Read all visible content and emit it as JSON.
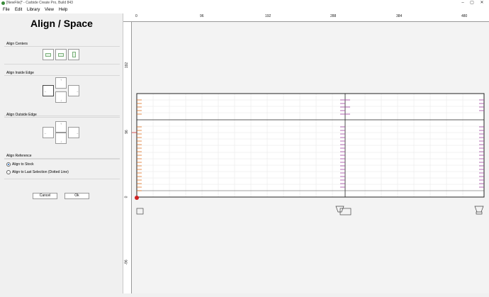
{
  "window": {
    "title": "[NewFile]* - Carbide Create Pro, Build 843",
    "min": "–",
    "max": "▢",
    "close": "✕"
  },
  "menu": [
    "File",
    "Edit",
    "Library",
    "View",
    "Help"
  ],
  "panel": {
    "title": "Align / Space",
    "align_centers": "Align Centers",
    "align_inside": "Align Inside Edge",
    "align_outside": "Align Outside Edge",
    "reference": "Align Reference",
    "ref_options": [
      "Align to Stock",
      "Align to Last Selection (Dotted Line)"
    ],
    "selected_option": "Align to Stock",
    "cancel": "Cancel",
    "ok": "Ok"
  },
  "ruler": {
    "top_labels": [
      "0",
      "96",
      "192",
      "288",
      "384",
      "480"
    ],
    "left_labels": [
      "192",
      "96",
      "0",
      "-96"
    ]
  },
  "colors": {
    "accent": "#1a5fb4",
    "stock_border": "#222222",
    "left_marks": "#e07020",
    "mid_marks": "#a040a0",
    "origin": "#d02020"
  }
}
